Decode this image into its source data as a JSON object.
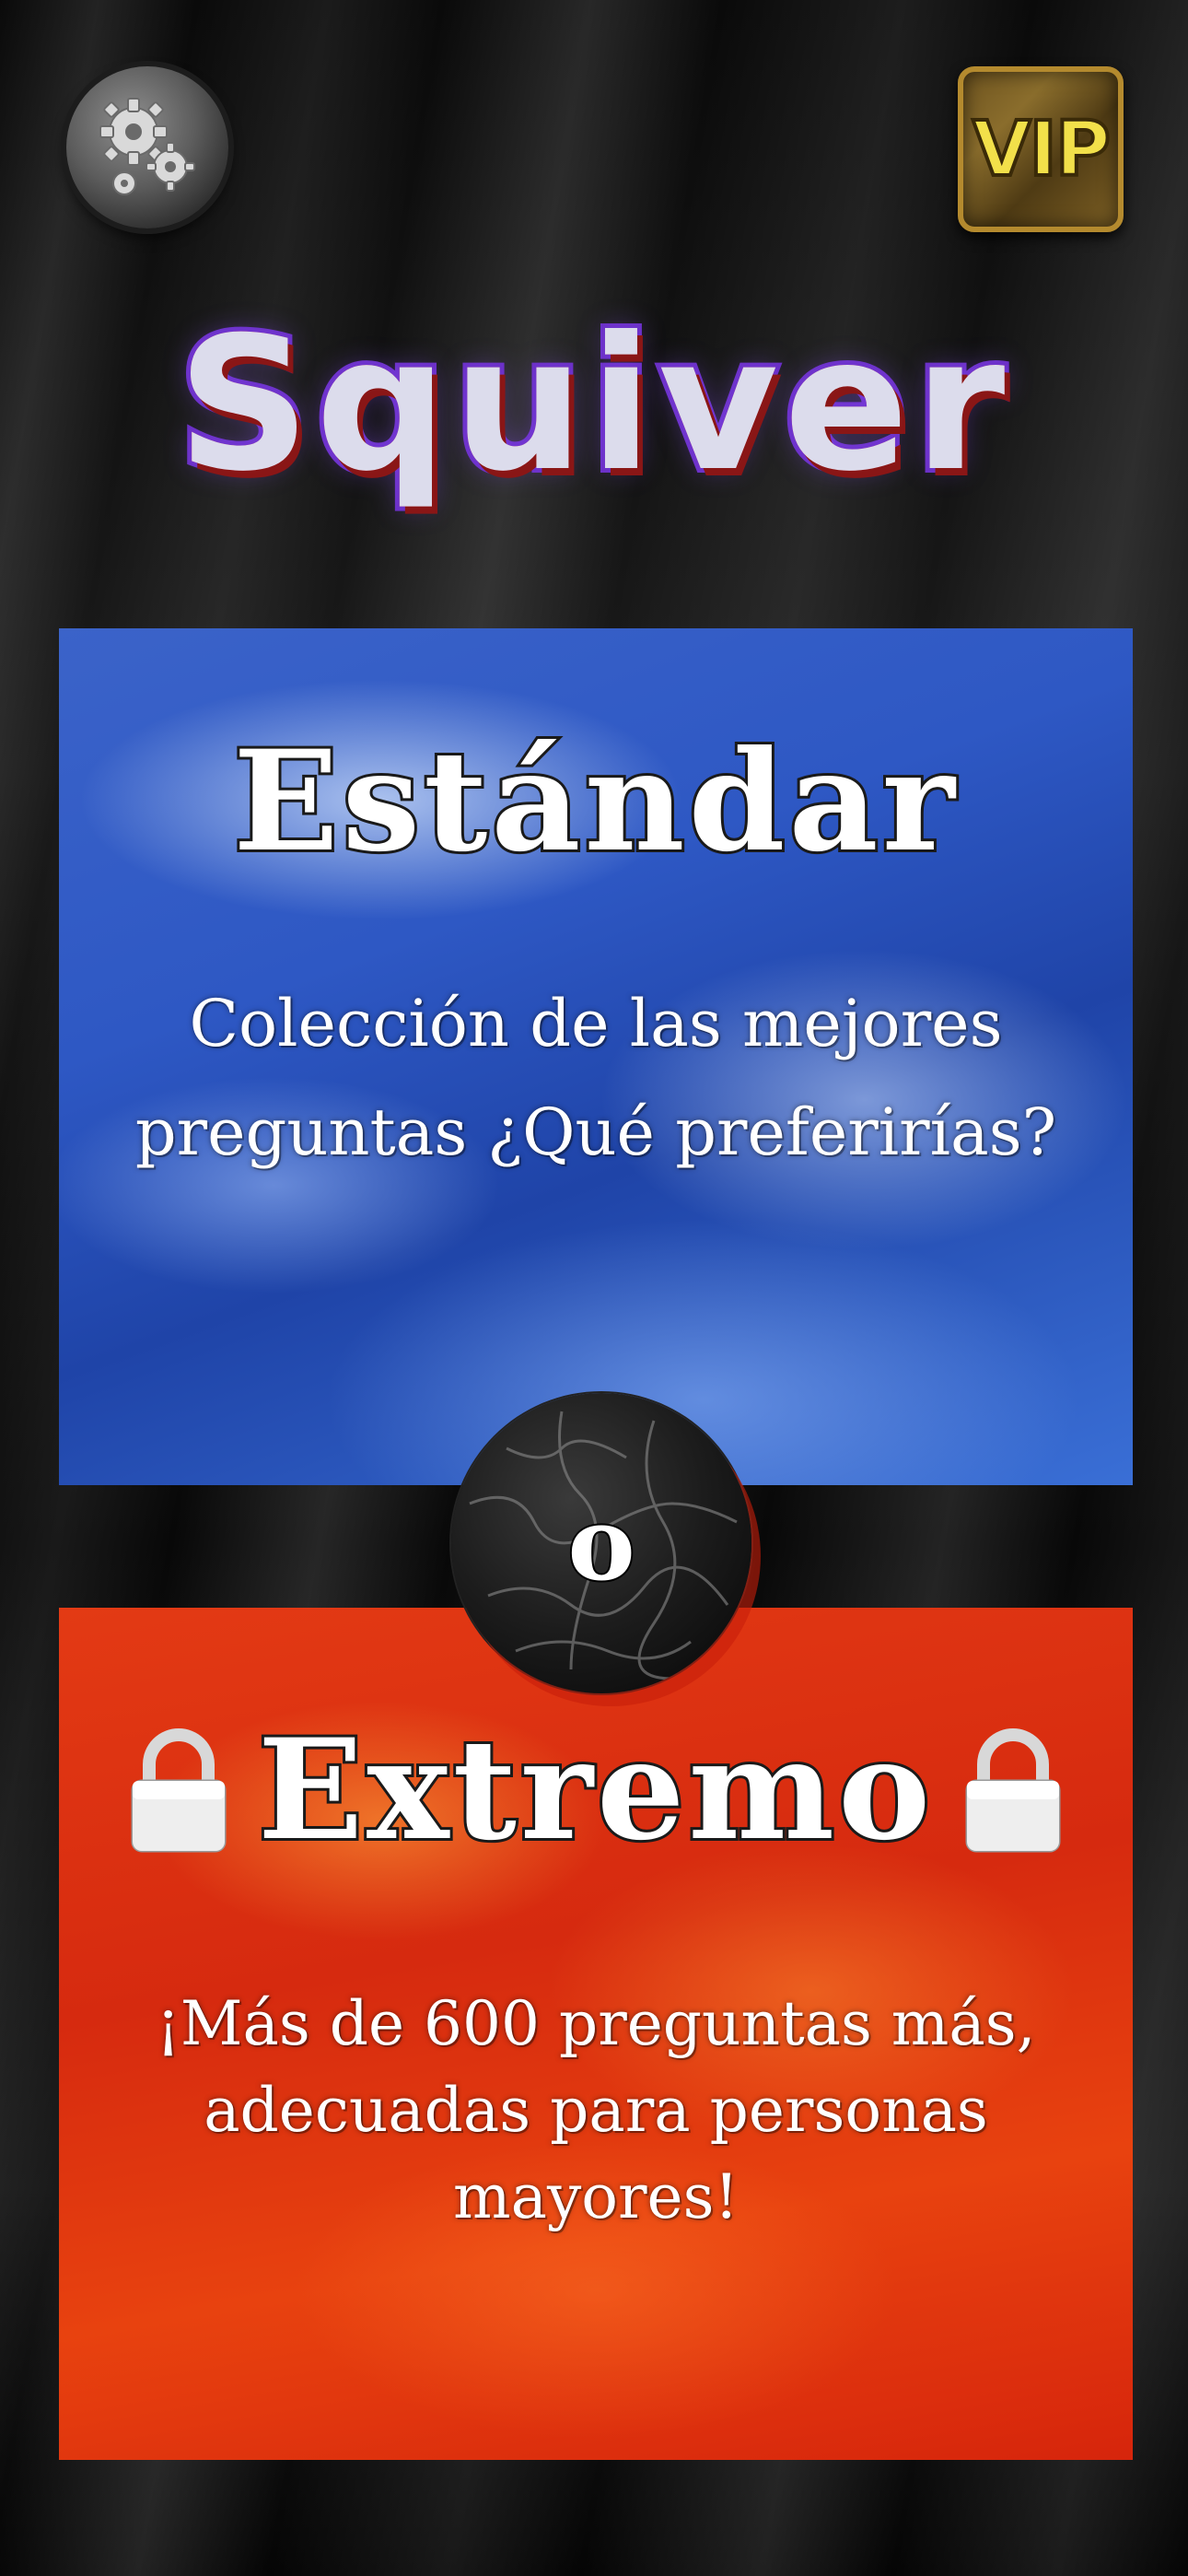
{
  "app": {
    "title": "Squiver"
  },
  "header": {
    "settings_icon": "gears-icon",
    "vip_label": "VIP"
  },
  "modes": [
    {
      "name": "Estándar",
      "description_line1": "Colección de las mejores",
      "description_line2": "preguntas ¿Qué preferirías?",
      "color": "#2e58c4",
      "locked": false
    },
    {
      "name": "Extremo",
      "description_line1": "¡Más de 600 preguntas más,",
      "description_line2": "adecuadas para personas mayores!",
      "color": "#e33a14",
      "locked": true,
      "lock_icon": "padlock-icon"
    }
  ],
  "divider": {
    "label": "o"
  }
}
